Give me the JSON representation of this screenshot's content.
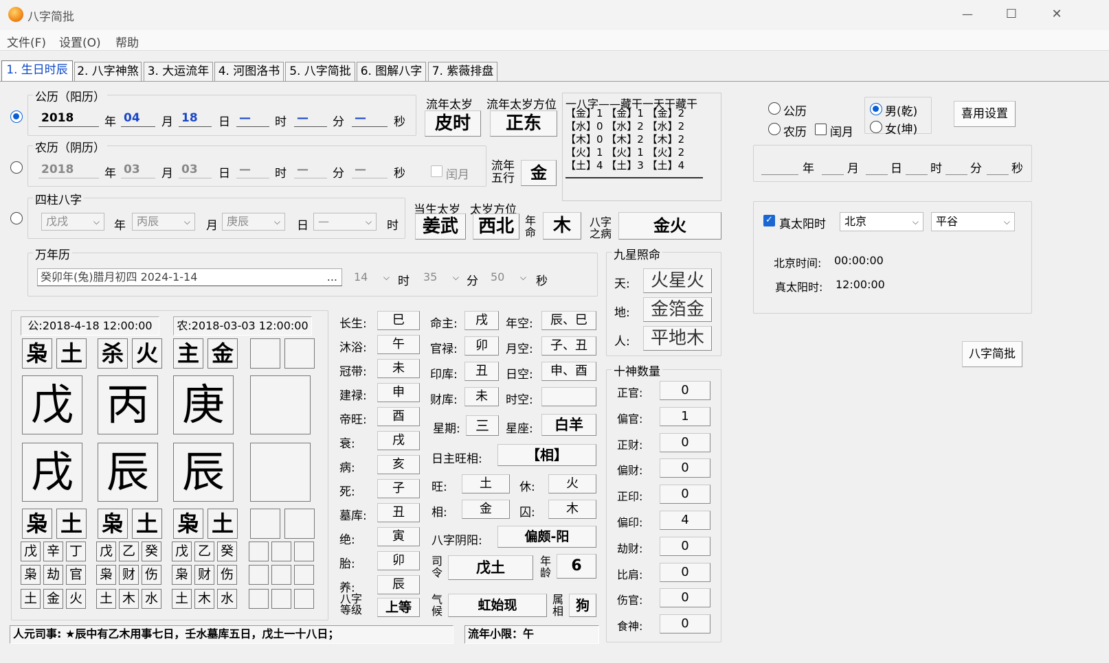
{
  "window": {
    "title": "八字简批",
    "minimize": "—",
    "maximize": "☐",
    "close": "✕",
    "app_icon": "app-icon"
  },
  "menu": [
    "文件(F)",
    "设置(O)",
    "帮助"
  ],
  "tabs": [
    "1. 生日时辰",
    "2. 八字神煞",
    "3. 大运流年",
    "4. 河图洛书",
    "5. 八字简批",
    "6. 图解八字",
    "7. 紫薇排盘"
  ],
  "solar": {
    "title": "公历（阳历）",
    "year": "2018",
    "month": "04",
    "day": "18",
    "hour": "—",
    "minute": "—",
    "second": "—",
    "u_year": "年",
    "u_month": "月",
    "u_day": "日",
    "u_hour": "时",
    "u_minute": "分",
    "u_second": "秒"
  },
  "lunar": {
    "title": "农历（阴历）",
    "year": "2018",
    "month": "03",
    "day": "03",
    "hour": "—",
    "minute": "—",
    "second": "—",
    "leap": "闰月"
  },
  "sizhu": {
    "title": "四柱八字",
    "year": "戊戌",
    "month": "丙辰",
    "day": "庚辰",
    "hour": "—",
    "u_year": "年",
    "u_month": "月",
    "u_day": "日",
    "u_hour": "时"
  },
  "wannian": {
    "title": "万年历",
    "date": "癸卯年(兔)腊月初四 2024-1-14",
    "more": "...",
    "hour": "14",
    "minute": "35",
    "second": "50",
    "u_hour": "时",
    "u_minute": "分",
    "u_second": "秒"
  },
  "taisui": {
    "liunian_label": "流年太岁",
    "liunian": "皮时",
    "fangwei_label": "流年太岁方位",
    "fangwei": "正东",
    "wuxing_label": "流年五行",
    "wuxing": "金",
    "dangsheng_label": "当生太岁",
    "dangsheng": "姜武",
    "ts_fw_label": "太岁方位",
    "ts_fw": "西北",
    "nianming_label": "年命",
    "nianming": "木",
    "bazi_bing_label": "八字之病",
    "bazi_bing": "金火"
  },
  "canggan": {
    "header": "一八字——藏干一天干藏干",
    "rows": [
      "【金】1 【金】1 【金】2",
      "【水】0 【水】2 【水】2",
      "【木】0 【木】2 【木】2",
      "【火】1 【火】1 【火】2",
      "【土】4 【土】3 【土】4"
    ]
  },
  "right": {
    "gongli": "公历",
    "nongli": "农历",
    "leap": "闰月",
    "male": "男(乾)",
    "female": "女(坤)",
    "xiyong": "喜用设置",
    "u_year": "年",
    "u_month": "月",
    "u_day": "日",
    "u_hour": "时",
    "u_minute": "分",
    "u_second": "秒",
    "true_solar": "真太阳时",
    "province": "北京",
    "city": "平谷",
    "bj_label": "北京时间:",
    "bj_time": "00:00:00",
    "ts_label": "真太阳时:",
    "ts_time": "12:00:00",
    "jianpi": "八字简批"
  },
  "chart": {
    "solar_date": "公:2018-4-18 12:00:00",
    "lunar_date": "农:2018-03-03 12:00:00",
    "top": [
      [
        "枭",
        "土"
      ],
      [
        "杀",
        "火"
      ],
      [
        "主",
        "金"
      ]
    ],
    "stems": [
      "戊",
      "丙",
      "庚"
    ],
    "branches": [
      "戌",
      "辰",
      "辰"
    ],
    "bottom": [
      [
        "枭",
        "土"
      ],
      [
        "枭",
        "土"
      ],
      [
        "枭",
        "土"
      ]
    ],
    "hidden": [
      [
        "戊",
        "辛",
        "丁"
      ],
      [
        "戊",
        "乙",
        "癸"
      ],
      [
        "戊",
        "乙",
        "癸"
      ]
    ],
    "gods": [
      [
        "枭",
        "劫",
        "官"
      ],
      [
        "枭",
        "财",
        "伤"
      ],
      [
        "枭",
        "财",
        "伤"
      ]
    ],
    "elems": [
      [
        "土",
        "金",
        "火"
      ],
      [
        "土",
        "木",
        "水"
      ],
      [
        "土",
        "木",
        "水"
      ]
    ]
  },
  "changsheng": [
    [
      "长生:",
      "巳"
    ],
    [
      "沐浴:",
      "午"
    ],
    [
      "冠带:",
      "未"
    ],
    [
      "建禄:",
      "申"
    ],
    [
      "帝旺:",
      "酉"
    ],
    [
      "衰:",
      "戌"
    ],
    [
      "病:",
      "亥"
    ],
    [
      "死:",
      "子"
    ],
    [
      "墓库:",
      "丑"
    ],
    [
      "绝:",
      "寅"
    ],
    [
      "胎:",
      "卯"
    ],
    [
      "养:",
      "辰"
    ]
  ],
  "grade": {
    "label": "八字等级",
    "value": "上等"
  },
  "ming": [
    [
      "命主:",
      "戌",
      "年空:",
      "辰、巳"
    ],
    [
      "官禄:",
      "卯",
      "月空:",
      "子、丑"
    ],
    [
      "印库:",
      "丑",
      "日空:",
      "申、酉"
    ],
    [
      "财库:",
      "未",
      "时空:",
      ""
    ]
  ],
  "xingqi": {
    "label": "星期:",
    "value": "三",
    "xz_label": "星座:",
    "xz": "白羊"
  },
  "wangxiang": {
    "label": "日主旺相:",
    "value": "【相】",
    "wang": "旺:",
    "wang_v": "土",
    "xiu": "休:",
    "xiu_v": "火",
    "xiang": "相:",
    "xiang_v": "金",
    "qiu": "囚:",
    "qiu_v": "木"
  },
  "yinyang": {
    "label": "八字阴阳:",
    "value": "偏颇-阳"
  },
  "siling": {
    "label": "司令",
    "value": "戊土",
    "age_label": "年龄",
    "age": "6"
  },
  "qihou": {
    "label": "气候",
    "value": "虹始现",
    "sx_label": "属相",
    "sx": "狗"
  },
  "jiuxing": {
    "title": "九星照命",
    "tian": "天:",
    "tian_v": "火星火",
    "di": "地:",
    "di_v": "金箔金",
    "ren": "人:",
    "ren_v": "平地木"
  },
  "shishen": {
    "title": "十神数量",
    "items": [
      [
        "正官:",
        "0"
      ],
      [
        "偏官:",
        "1"
      ],
      [
        "正财:",
        "0"
      ],
      [
        "偏财:",
        "0"
      ],
      [
        "正印:",
        "0"
      ],
      [
        "偏印:",
        "4"
      ],
      [
        "劫财:",
        "0"
      ],
      [
        "比肩:",
        "0"
      ],
      [
        "伤官:",
        "0"
      ],
      [
        "食神:",
        "0"
      ]
    ]
  },
  "status": {
    "renyuan": "人元司事:  ★辰中有乙木用事七日，壬水墓库五日，戊土一十八日；",
    "xiaoxian": "流年小限：午"
  },
  "colors": {
    "accent": "#0a5fd6",
    "tab_active": "#0a47c8",
    "blue_text": "#1a47c6"
  }
}
